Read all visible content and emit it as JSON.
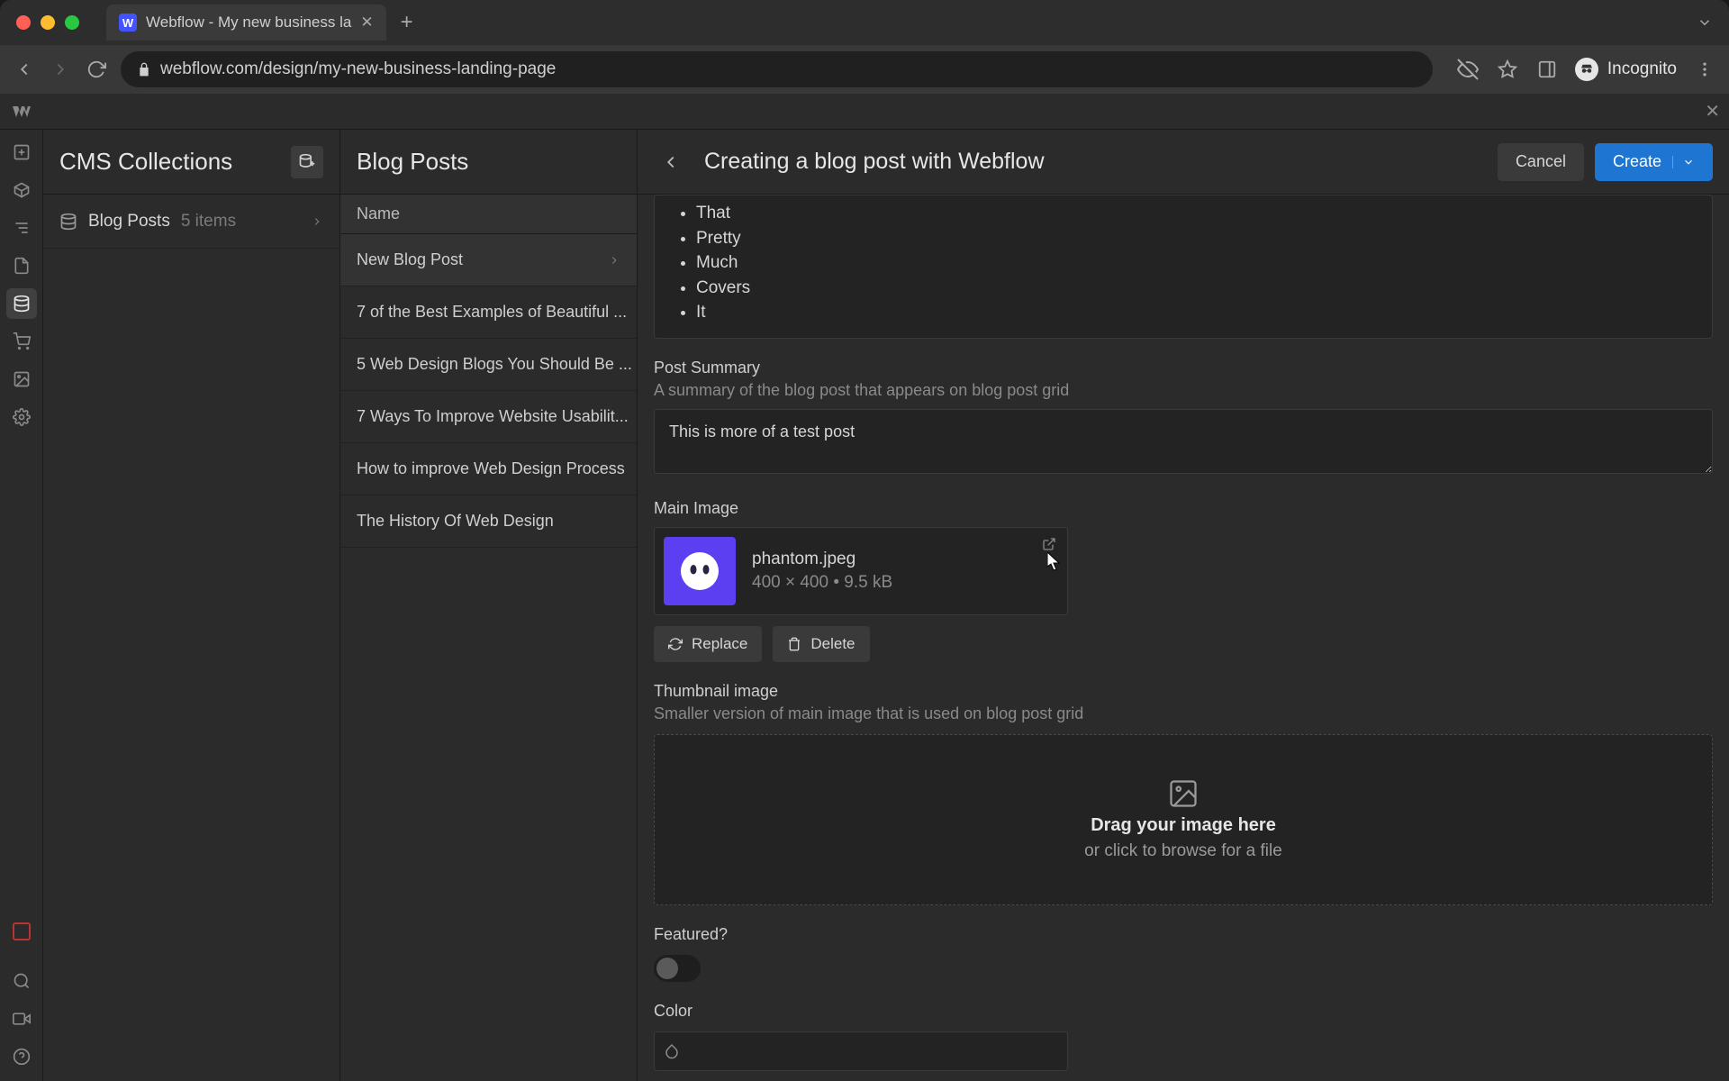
{
  "browser": {
    "tab_title": "Webflow - My new business la",
    "url": "webflow.com/design/my-new-business-landing-page",
    "incognito_label": "Incognito"
  },
  "collections": {
    "title": "CMS Collections",
    "item_label": "Blog Posts",
    "item_count": "5 items"
  },
  "posts": {
    "title": "Blog Posts",
    "column_header": "Name",
    "items": [
      "New Blog Post",
      "7 of the Best Examples of Beautiful ...",
      "5 Web Design Blogs You Should Be ...",
      "7 Ways To Improve Website Usabilit...",
      "How to improve Web Design Process",
      "The History Of Web Design"
    ]
  },
  "editor": {
    "title": "Creating a blog post with Webflow",
    "cancel": "Cancel",
    "create": "Create",
    "bullets": [
      "That",
      "Pretty",
      "Much",
      "Covers",
      "It"
    ],
    "summary_label": "Post Summary",
    "summary_hint": "A summary of the blog post that appears on blog post grid",
    "summary_value": "This is more of a test post",
    "main_image_label": "Main Image",
    "image_name": "phantom.jpeg",
    "image_meta": "400 × 400 • 9.5 kB",
    "replace": "Replace",
    "delete": "Delete",
    "thumb_label": "Thumbnail image",
    "thumb_hint": "Smaller version of main image that is used on blog post grid",
    "dz_title": "Drag your image here",
    "dz_sub": "or click to browse for a file",
    "featured_label": "Featured?",
    "color_label": "Color"
  },
  "colors": {
    "accent": "#1f76d2",
    "thumb_bg": "#5b3ff0"
  }
}
